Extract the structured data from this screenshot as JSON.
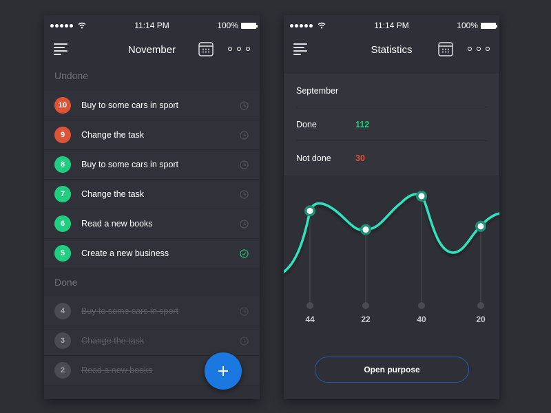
{
  "colors": {
    "red": "#dd5437",
    "green": "#1fcf7f",
    "gray_badge": "#4a4b53",
    "accent_blue": "#1a78e0",
    "chart_line": "#2fe3bd",
    "chart_point_ring": "#1f8f78"
  },
  "status_bar": {
    "time": "11:14 PM",
    "battery": "100%"
  },
  "left_screen": {
    "title": "November",
    "sections": {
      "undone": "Undone",
      "done": "Done"
    },
    "undone_tasks": [
      {
        "number": "10",
        "label": "Buy to some cars in sport",
        "color": "red",
        "icon": "clock-icon"
      },
      {
        "number": "9",
        "label": "Change the task",
        "color": "red",
        "icon": "clock-icon"
      },
      {
        "number": "8",
        "label": "Buy to some cars in sport",
        "color": "green",
        "icon": "clock-icon"
      },
      {
        "number": "7",
        "label": "Change the task",
        "color": "green",
        "icon": "clock-icon"
      },
      {
        "number": "6",
        "label": "Read a new books",
        "color": "green",
        "icon": "clock-icon"
      },
      {
        "number": "5",
        "label": "Create a new business",
        "color": "green",
        "icon": "check-circle-icon"
      }
    ],
    "done_tasks": [
      {
        "number": "4",
        "label": "Buy to some cars in sport",
        "icon": "clock-icon"
      },
      {
        "number": "3",
        "label": "Change the task",
        "icon": "clock-icon"
      },
      {
        "number": "2",
        "label": "Read a new books",
        "icon": ""
      }
    ],
    "fab_icon": "plus-icon"
  },
  "right_screen": {
    "title": "Statistics",
    "month": "September",
    "stats": [
      {
        "label": "Done",
        "value": "112",
        "color": "green"
      },
      {
        "label": "Not done",
        "value": "30",
        "color": "red"
      }
    ],
    "open_button": "Open purpose"
  },
  "chart_data": {
    "type": "line",
    "title": "",
    "xlabel": "",
    "ylabel": "",
    "categories": [
      "44",
      "22",
      "40",
      "20"
    ],
    "values": [
      44,
      22,
      40,
      20
    ],
    "smooth": true,
    "grid": false,
    "legend": "none"
  }
}
